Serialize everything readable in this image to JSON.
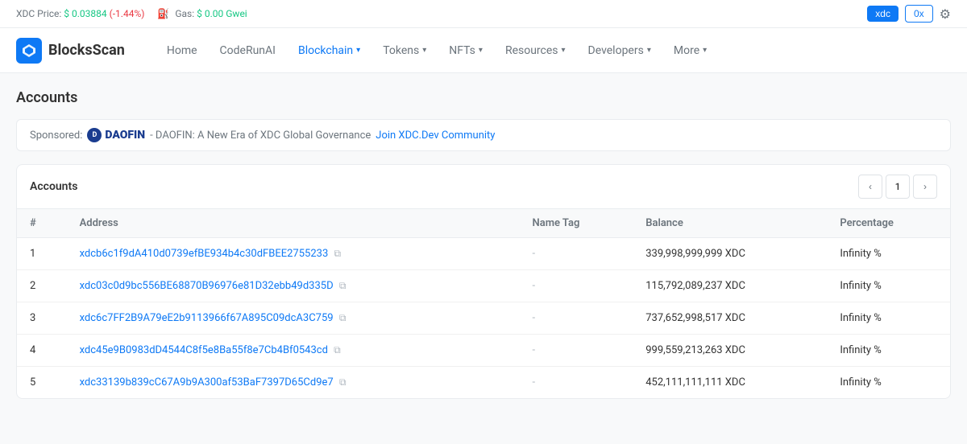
{
  "topbar": {
    "xdc_price_label": "XDC Price:",
    "xdc_price": "$ 0.03884",
    "xdc_change": "(-1.44%)",
    "gas_icon": "⛽",
    "gas_label": "Gas:",
    "gas_price": "$ 0.00 Gwei",
    "btn_xdc": "xdc",
    "btn_0x": "0x",
    "settings_icon": "⚙"
  },
  "nav": {
    "logo_text": "BlocksScan",
    "items": [
      {
        "label": "Home",
        "has_dropdown": false,
        "active": false
      },
      {
        "label": "CodeRunAI",
        "has_dropdown": false,
        "active": false
      },
      {
        "label": "Blockchain",
        "has_dropdown": true,
        "active": true
      },
      {
        "label": "Tokens",
        "has_dropdown": true,
        "active": false
      },
      {
        "label": "NFTs",
        "has_dropdown": true,
        "active": false
      },
      {
        "label": "Resources",
        "has_dropdown": true,
        "active": false
      },
      {
        "label": "Developers",
        "has_dropdown": true,
        "active": false
      },
      {
        "label": "More",
        "has_dropdown": true,
        "active": false
      }
    ]
  },
  "page": {
    "title": "Accounts",
    "sponsored_label": "Sponsored:",
    "daofin_name": "DAOFIN",
    "daofin_desc": "- DAOFIN: A New Era of XDC Global Governance",
    "daofin_link": "Join XDC.Dev Community"
  },
  "table": {
    "title": "Accounts",
    "pagination": {
      "prev_label": "‹",
      "current_page": "1",
      "next_label": "›"
    },
    "columns": [
      "#",
      "Address",
      "Name Tag",
      "Balance",
      "Percentage"
    ],
    "rows": [
      {
        "num": "1",
        "address": "xdcb6c1f9dA410d0739efBE934b4c30dFBEE2755233",
        "name_tag": "-",
        "balance": "339,998,999,999 XDC",
        "percentage": "Infinity %"
      },
      {
        "num": "2",
        "address": "xdc03c0d9bc556BE68870B96976e81D32ebb49d335D",
        "name_tag": "-",
        "balance": "115,792,089,237 XDC",
        "percentage": "Infinity %"
      },
      {
        "num": "3",
        "address": "xdc6c7FF2B9A79eE2b9113966f67A895C09dcA3C759",
        "name_tag": "-",
        "balance": "737,652,998,517 XDC",
        "percentage": "Infinity %"
      },
      {
        "num": "4",
        "address": "xdc45e9B0983dD4544C8f5e8Ba55f8e7Cb4Bf0543cd",
        "name_tag": "-",
        "balance": "999,559,213,263 XDC",
        "percentage": "Infinity %"
      },
      {
        "num": "5",
        "address": "xdc33139b839cC67A9b9A300af53BaF7397D65Cd9e7",
        "name_tag": "-",
        "balance": "452,111,111,111 XDC",
        "percentage": "Infinity %"
      }
    ]
  }
}
